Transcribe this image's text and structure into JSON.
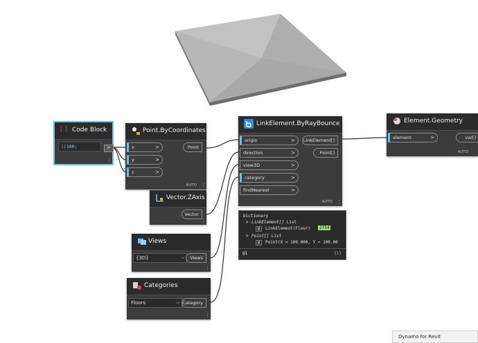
{
  "code_block": {
    "title": "Code Block",
    "line_number": "1",
    "code": "100;",
    "out_label": ">"
  },
  "point_by_coordinates": {
    "title": "Point.ByCoordinates",
    "inputs": [
      "x",
      "y",
      "z"
    ],
    "output": "Point",
    "auto": "AUTO"
  },
  "vector_zaxis": {
    "title": "Vector.ZAxis",
    "output": "Vector"
  },
  "views": {
    "title": "Views",
    "selected": "{3D}",
    "output": "Views"
  },
  "categories": {
    "title": "Categories",
    "selected": "Floors",
    "output": "Category"
  },
  "ray_bounce": {
    "title": "LinkElement.ByRayBounce",
    "inputs": [
      "origin",
      "direction",
      "view3D",
      "category",
      "findNearest"
    ],
    "outputs": [
      "LinkElement[]",
      "Point[]"
    ],
    "auto": "AUTO"
  },
  "element_geometry": {
    "title": "Element.Geometry",
    "input": "element",
    "output": "var[]",
    "auto": "AUTO"
  },
  "watch": {
    "header": "Dictionary",
    "row1_label": "LinkElement[]",
    "row1_suffix": "List",
    "row1_index": "@",
    "row1_value": "LinkElement(Floor)",
    "row1_badge": "2754",
    "row2_label": "Point[]",
    "row2_suffix": "List",
    "row2_index": "@",
    "row2_value": "Point(X = 100.000, Y = 100.00",
    "level": "@1",
    "count": "{1}"
  },
  "footer": {
    "text": "Dynamo for Revit"
  },
  "colors": {
    "node_body": "#3c3c3c",
    "node_header": "#2b2b2b",
    "selection": "#6ac0e7",
    "wire": "#2f2f2f",
    "badge": "#96e07a"
  }
}
